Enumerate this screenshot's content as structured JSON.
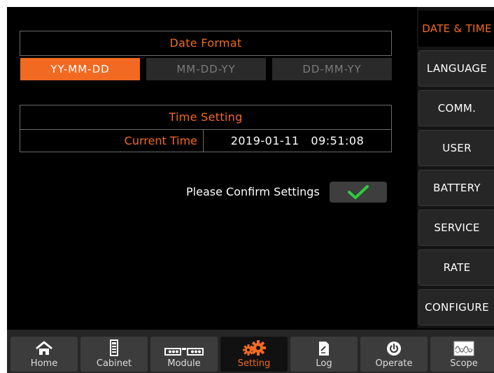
{
  "date_format": {
    "title": "Date Format",
    "options": [
      "YY-MM-DD",
      "MM-DD-YY",
      "DD-MM-YY"
    ],
    "selected": "YY-MM-DD"
  },
  "time_setting": {
    "title": "Time Setting",
    "current_time_label": "Current Time",
    "current_time_value": "2019-01-11   09:51:08"
  },
  "confirm": {
    "text": "Please Confirm Settings",
    "icon": "checkmark-icon"
  },
  "side_menu": {
    "items": [
      "DATE & TIME",
      "LANGUAGE",
      "COMM.",
      "USER",
      "BATTERY",
      "SERVICE",
      "RATE",
      "CONFIGURE"
    ],
    "active": "DATE & TIME"
  },
  "bottom_nav": {
    "items": [
      {
        "label": "Home",
        "icon": "home-icon"
      },
      {
        "label": "Cabinet",
        "icon": "cabinet-icon"
      },
      {
        "label": "Module",
        "icon": "module-icon"
      },
      {
        "label": "Setting",
        "icon": "gears-icon"
      },
      {
        "label": "Log",
        "icon": "log-icon"
      },
      {
        "label": "Operate",
        "icon": "power-icon"
      },
      {
        "label": "Scope",
        "icon": "scope-icon"
      }
    ],
    "active": "Setting"
  },
  "colors": {
    "accent": "#f26a21",
    "check": "#2ecc40",
    "background": "#000000"
  }
}
